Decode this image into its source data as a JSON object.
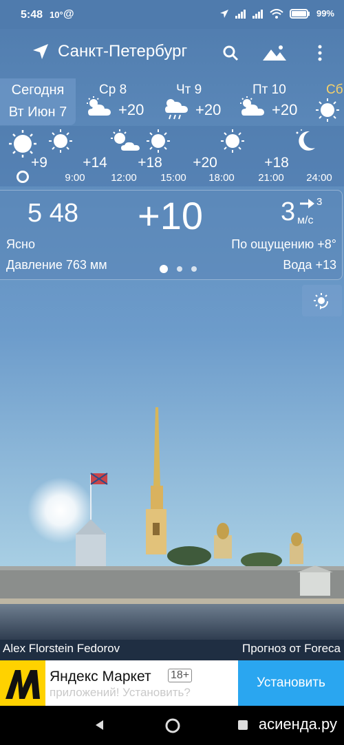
{
  "status_bar": {
    "time": "5:48",
    "temp": "10°",
    "at": "@",
    "battery": "99%"
  },
  "app": {
    "city": "Санкт-Петербург"
  },
  "days": [
    {
      "name": "Сегодня",
      "date": "Вт Июн 7"
    },
    {
      "name": "Ср 8",
      "temp": "+20",
      "icon": "partly-cloudy-icon"
    },
    {
      "name": "Чт 9",
      "temp": "+20",
      "icon": "rain-icon"
    },
    {
      "name": "Пт 10",
      "temp": "+20",
      "icon": "partly-cloudy-icon"
    },
    {
      "name": "Сб",
      "icon": "sun-icon"
    }
  ],
  "hourly": [
    {
      "temp": "+9",
      "time": "",
      "icon": "sun-icon"
    },
    {
      "temp": "+14",
      "time": "9:00",
      "icon": "sun-icon"
    },
    {
      "temp": "+18",
      "time": "12:00",
      "icon": "partly-cloudy-icon"
    },
    {
      "temp": "",
      "time": "15:00",
      "icon": "sun-icon"
    },
    {
      "temp": "+20",
      "time": "18:00",
      "icon": "sun-icon"
    },
    {
      "temp": "+18",
      "time": "21:00",
      "icon": "sun-icon"
    },
    {
      "temp": "",
      "time": "24:00",
      "icon": "moon-icon"
    }
  ],
  "current": {
    "time": "5 48",
    "temp": "+10",
    "wind": "3",
    "wind_gust": "3",
    "wind_unit": "м/с",
    "condition": "Ясно",
    "feels_like": "По ощущению +8°",
    "pressure": "Давление 763 мм",
    "water": "Вода +13"
  },
  "credits": {
    "photo": "Alex Florstein Fedorov",
    "forecast": "Прогноз от Foreca"
  },
  "ad": {
    "title": "Яндекс Маркет",
    "age": "18+",
    "subtitle": "приложений! Установить?",
    "button": "Установить"
  },
  "watermark": "асиенда.ру",
  "colors": {
    "sky_top": "#4f7bad",
    "sky_bottom": "#a6cde3",
    "ad_button": "#2aa6f0",
    "ad_logo": "#ffd200"
  }
}
